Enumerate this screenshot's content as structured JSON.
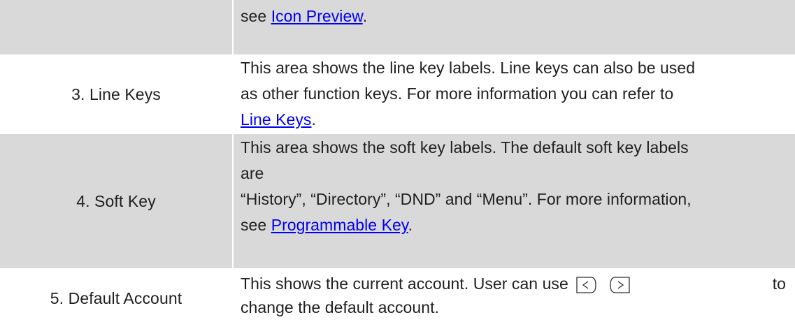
{
  "rows": [
    {
      "left": "",
      "right": {
        "prefix": "see ",
        "link": "Icon Preview",
        "suffix": "."
      }
    },
    {
      "left": "3. Line Keys",
      "right": {
        "line1": "This area shows the line key labels. Line keys can also be used",
        "line2": "as other function keys. For more information you can refer to",
        "link": "Line Keys",
        "suffix": "."
      }
    },
    {
      "left": "4. Soft Key",
      "right": {
        "line1": "This area shows the soft key labels. The default soft key labels",
        "line2": "are",
        "line3": "“History”, “Directory”, “DND” and “Menu”. For more information,",
        "prefix": "see ",
        "link": "Programmable Key",
        "suffix": "."
      }
    },
    {
      "left": "5. Default Account",
      "right": {
        "line1_start": "This shows the current account. User can use",
        "line1_end": "to",
        "line2": "change the default account."
      }
    }
  ],
  "icons": {
    "left_key": "left-arrow-key-icon",
    "right_key": "right-arrow-key-icon"
  },
  "colors": {
    "shaded": "#d9d9d9",
    "link": "#0000ee",
    "text": "#1f1f1f"
  }
}
